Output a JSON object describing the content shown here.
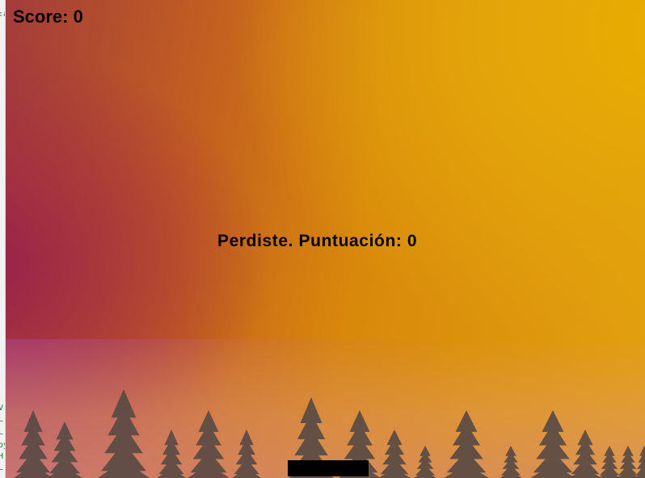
{
  "game": {
    "score_text": "Score: 0",
    "game_over_text": "Perdiste. Puntuación: 0"
  },
  "left_strip": {
    "lines": [
      ":a",
      "",
      "",
      "",
      "",
      "",
      "",
      "",
      "",
      "",
      "",
      "",
      "",
      "",
      "",
      "",
      "",
      "",
      "",
      "",
      "",
      "",
      "",
      "",
      "",
      "",
      "",
      "",
      "",
      "",
      "",
      "",
      "",
      "",
      "",
      "",
      "",
      "",
      "",
      "",
      "",
      "",
      "",
      "",
      "V",
      "L",
      "L",
      "oy",
      "H",
      "L"
    ]
  },
  "colors": {
    "sky_warm": "#e9ad00",
    "sky_magenta": "#961c50",
    "tree": "#5a4a44",
    "paddle": "#000000",
    "text": "#000000"
  }
}
